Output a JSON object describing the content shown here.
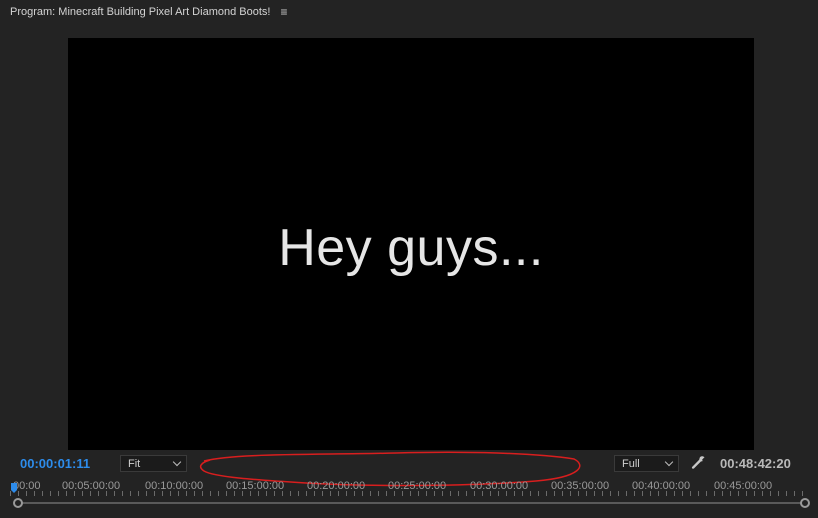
{
  "panel": {
    "title": "Program: Minecraft Building Pixel Art Diamond Boots!",
    "menu_icon": "≡"
  },
  "viewer": {
    "caption": "Hey guys..."
  },
  "controls": {
    "current_timecode": "00:00:01:11",
    "zoom_level": "Fit",
    "playback_resolution": "Full",
    "wrench_icon": "wrench-icon",
    "duration_timecode": "00:48:42:20"
  },
  "ruler": {
    "labels": [
      "00:00",
      "00:05:00:00",
      "00:10:00:00",
      "00:15:00:00",
      "00:20:00:00",
      "00:25:00:00",
      "00:30:00:00",
      "00:35:00:00",
      "00:40:00:00",
      "00:45:00:00"
    ]
  },
  "colors": {
    "accent_blue": "#2d8ceb",
    "annotation_red": "#d81e1e",
    "panel_bg": "#232323"
  }
}
